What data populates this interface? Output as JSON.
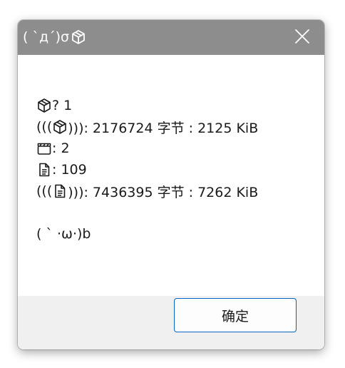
{
  "dialog": {
    "title": "( `д´)σ",
    "title_icon": "package-icon",
    "close_icon": "close-icon",
    "lines": [
      {
        "icon": "package-icon",
        "text": "? 1"
      },
      {
        "prefix": "(((",
        "icon": "package-icon",
        "text": "))): 2176724 字节 : 2125 KiB"
      },
      {
        "icon": "clapperboard-icon",
        "text": ": 2"
      },
      {
        "icon": "document-icon",
        "text": ": 109"
      },
      {
        "prefix": "(((",
        "icon": "document-icon",
        "text": "))): 7436395 字节 : 7262 KiB"
      },
      {
        "text": "( ` ·ω·)b"
      }
    ],
    "ok_label": "确定"
  },
  "colors": {
    "titlebar": "#8d8d8d",
    "button_border": "#0067c0",
    "footer": "#f0f0f0"
  }
}
